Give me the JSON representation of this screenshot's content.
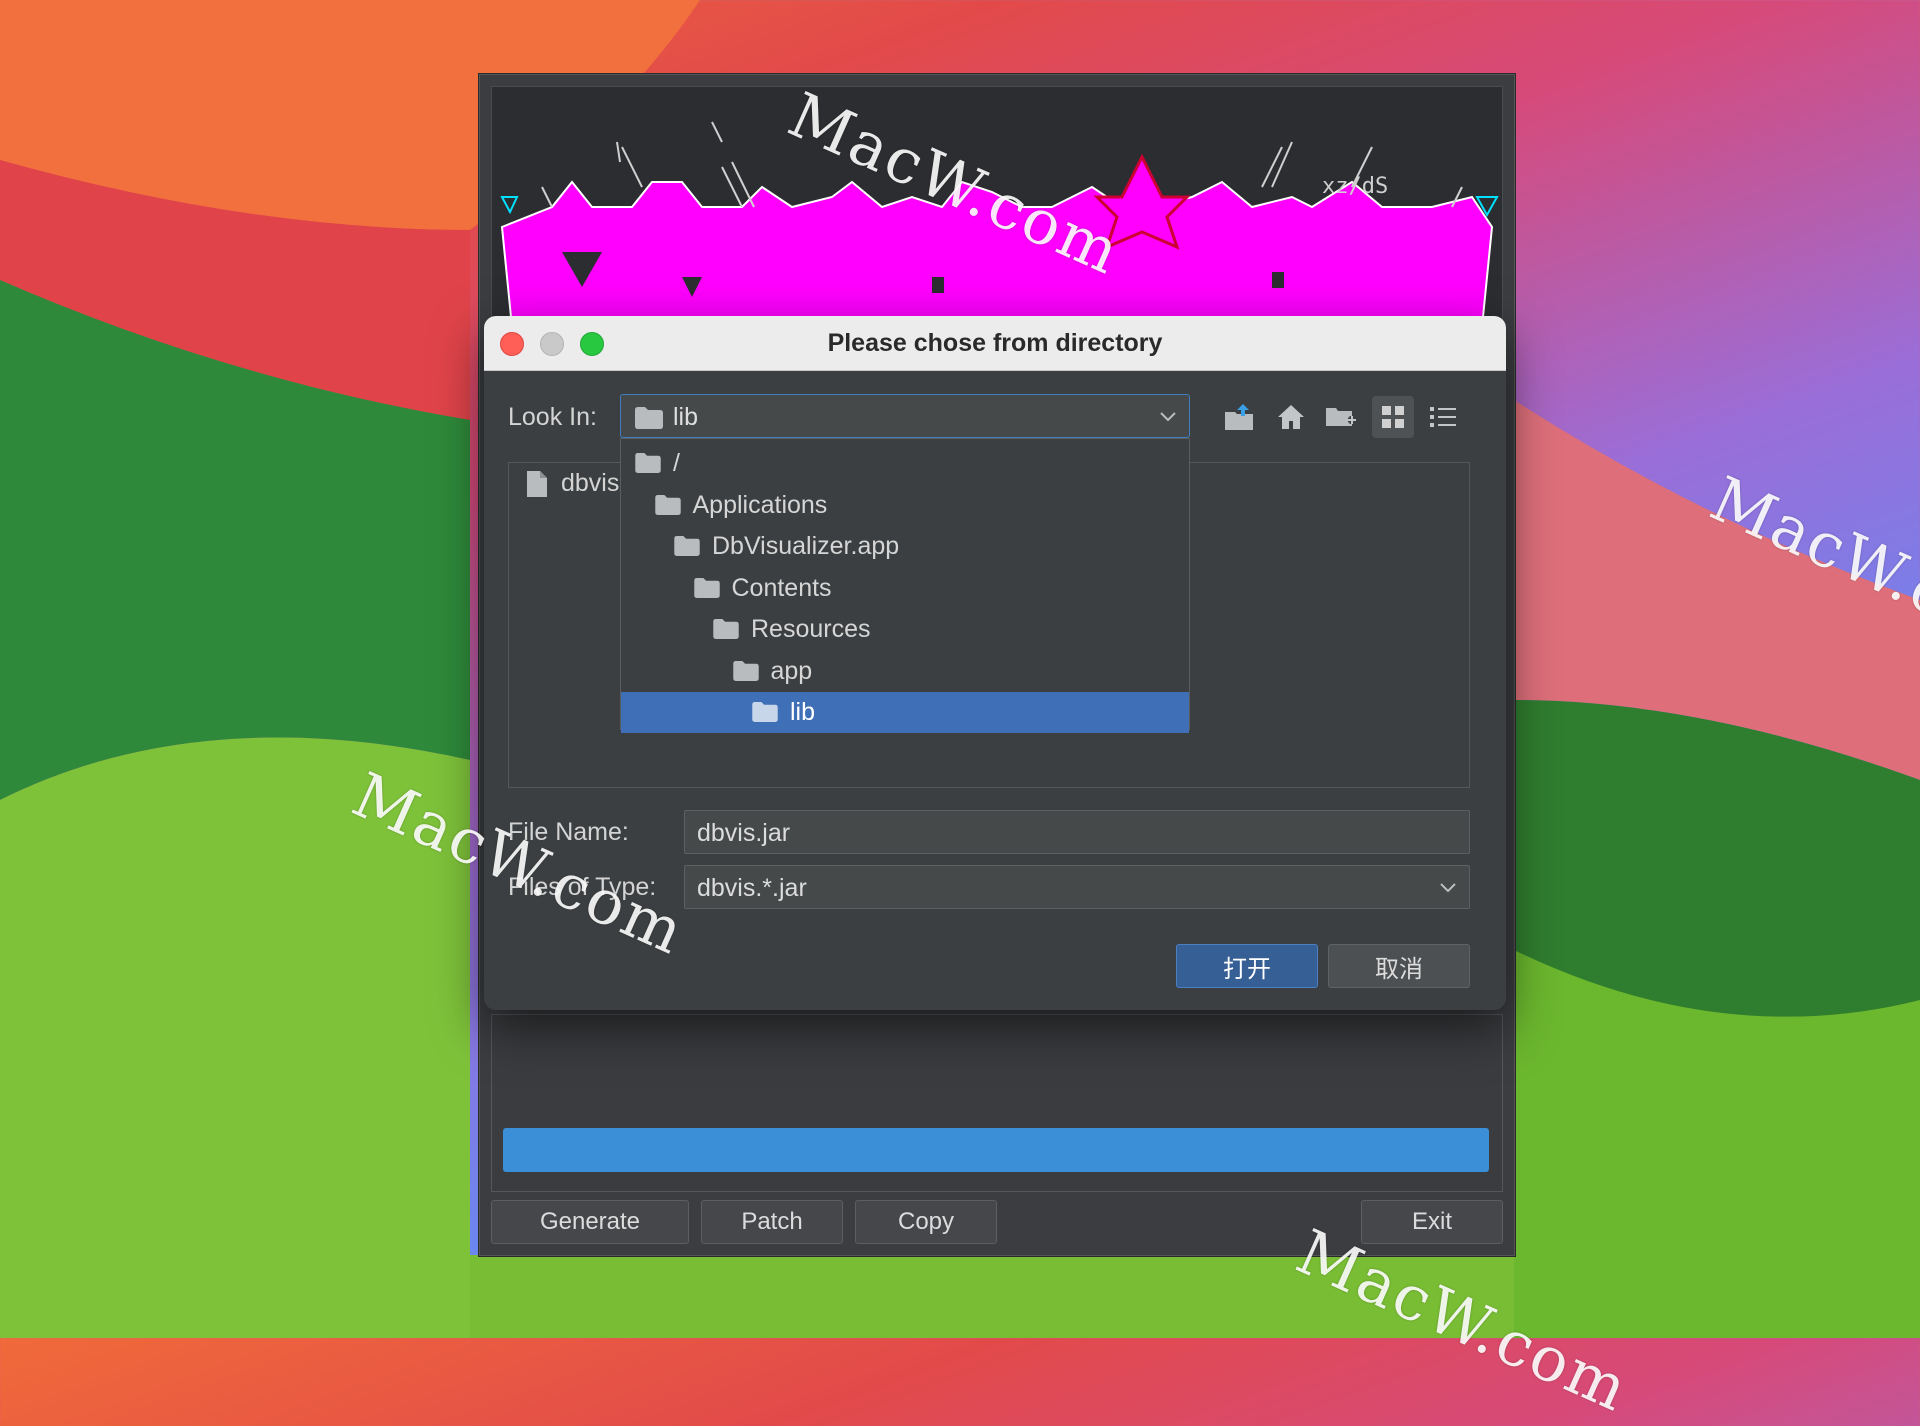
{
  "keygen": {
    "buttons": {
      "generate": "Generate",
      "patch": "Patch",
      "copy": "Copy",
      "exit": "Exit"
    },
    "progress": 1.0,
    "banner_text": [
      "xz/dS",
      "o",
      "o"
    ]
  },
  "dialog": {
    "title": "Please chose from directory",
    "look_in_label": "Look In:",
    "look_in_value": "lib",
    "file_list": [
      {
        "name": "dbvis",
        "icon": "file-icon"
      }
    ],
    "path_dropdown": [
      {
        "label": "/",
        "depth": 0,
        "selected": false
      },
      {
        "label": "Applications",
        "depth": 1,
        "selected": false
      },
      {
        "label": "DbVisualizer.app",
        "depth": 2,
        "selected": false
      },
      {
        "label": "Contents",
        "depth": 3,
        "selected": false
      },
      {
        "label": "Resources",
        "depth": 4,
        "selected": false
      },
      {
        "label": "app",
        "depth": 5,
        "selected": false
      },
      {
        "label": "lib",
        "depth": 6,
        "selected": true
      }
    ],
    "file_name_label": "File Name:",
    "file_name_value": "dbvis.jar",
    "files_of_type_label": "Files of Type:",
    "files_of_type_value": "dbvis.*.jar",
    "open_button": "打开",
    "cancel_button": "取消",
    "toolbar_icons": [
      "up-folder-icon",
      "home-icon",
      "new-folder-icon",
      "grid-view-icon",
      "list-view-icon"
    ]
  },
  "watermark": "MacW.com",
  "colors": {
    "accent": "#3f6fb6",
    "progress": "#3a8fd6",
    "banner_magenta": "#ff00ff",
    "dialog_bg": "#3c3f41"
  }
}
